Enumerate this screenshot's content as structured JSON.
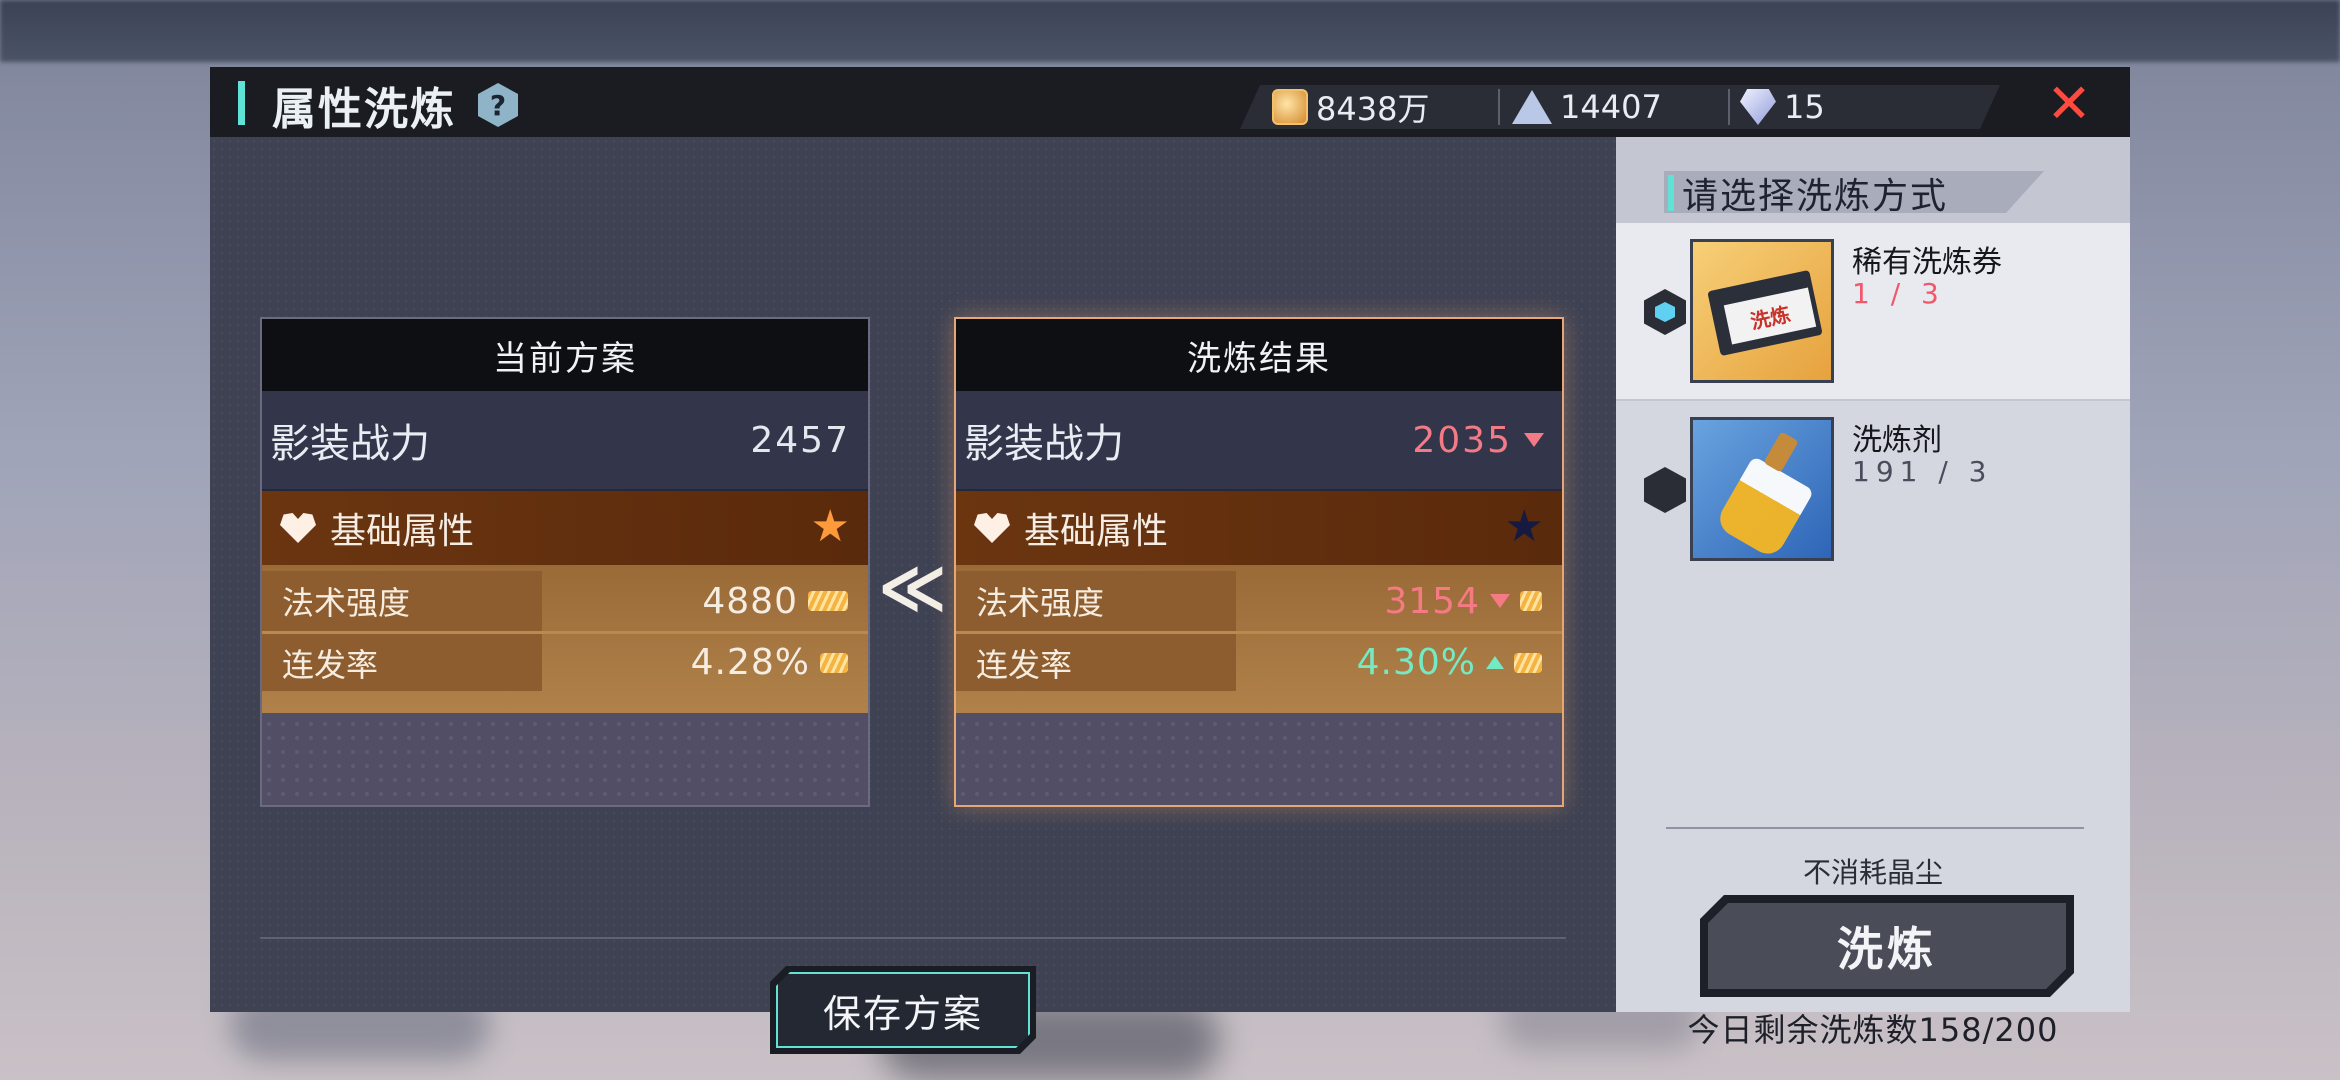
{
  "header": {
    "title": "属性洗炼",
    "help_label": "?",
    "close_label": "✕",
    "currencies": [
      {
        "icon": "gold-coin-icon",
        "value": "8438万"
      },
      {
        "icon": "crystal-tower-icon",
        "value": "14407"
      },
      {
        "icon": "diamond-icon",
        "value": "15"
      }
    ]
  },
  "current_plan": {
    "title": "当前方案",
    "power_label": "影装战力",
    "power_value": "2457",
    "attr_title": "基础属性",
    "star_color": "#ff9a3a",
    "stats": [
      {
        "name": "法术强度",
        "value": "4880"
      },
      {
        "name": "连发率",
        "value": "4.28%"
      }
    ]
  },
  "result_plan": {
    "title": "洗炼结果",
    "power_label": "影装战力",
    "power_value": "2035",
    "power_trend": "down",
    "attr_title": "基础属性",
    "star_color": "#161a40",
    "stats": [
      {
        "name": "法术强度",
        "value": "3154",
        "trend": "down"
      },
      {
        "name": "连发率",
        "value": "4.30%",
        "trend": "up"
      }
    ]
  },
  "transfer_arrow": "≪",
  "save_button": "保存方案",
  "method_panel": {
    "title": "请选择洗炼方式",
    "options": [
      {
        "name": "稀有洗炼券",
        "count": "1 / 3",
        "selected": true,
        "icon": "refine-ticket-icon",
        "ticket_text": "洗炼"
      },
      {
        "name": "洗炼剂",
        "count": "191 / 3",
        "selected": false,
        "icon": "refine-potion-icon"
      }
    ],
    "note": "不消耗晶尘",
    "refine_button": "洗炼",
    "remaining": "今日剩余洗炼数158/200"
  },
  "colors": {
    "accent": "#5fe3d6",
    "close": "#ff4a3d",
    "decrease": "#f47a86",
    "increase": "#74eac4"
  }
}
